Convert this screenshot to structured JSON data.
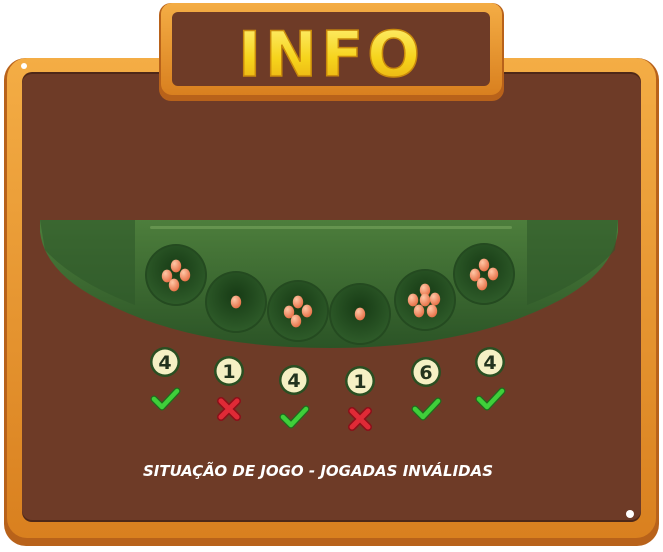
{
  "panel": {
    "title": "INFO",
    "caption": "SITUAÇÃO DE JOGO -  JOGADAS INVÁLIDAS"
  },
  "board": {
    "pits": [
      {
        "seeds": 4,
        "count_label": "4",
        "valid": true
      },
      {
        "seeds": 1,
        "count_label": "1",
        "valid": false
      },
      {
        "seeds": 4,
        "count_label": "4",
        "valid": true
      },
      {
        "seeds": 1,
        "count_label": "1",
        "valid": false
      },
      {
        "seeds": 6,
        "count_label": "6",
        "valid": true
      },
      {
        "seeds": 4,
        "count_label": "4",
        "valid": true
      }
    ]
  },
  "colors": {
    "frame_orange": "#e8952e",
    "frame_dark": "#b8621a",
    "panel_brown": "#6e3b27",
    "board_green": "#3d6b32",
    "title_yellow": "#f6d41c",
    "seed": "#f0906a",
    "valid_green": "#3fcf3a",
    "invalid_red": "#e02a36",
    "badge_fill": "#f5f0c4"
  },
  "icons": {
    "valid": "check-icon",
    "invalid": "cross-icon"
  }
}
